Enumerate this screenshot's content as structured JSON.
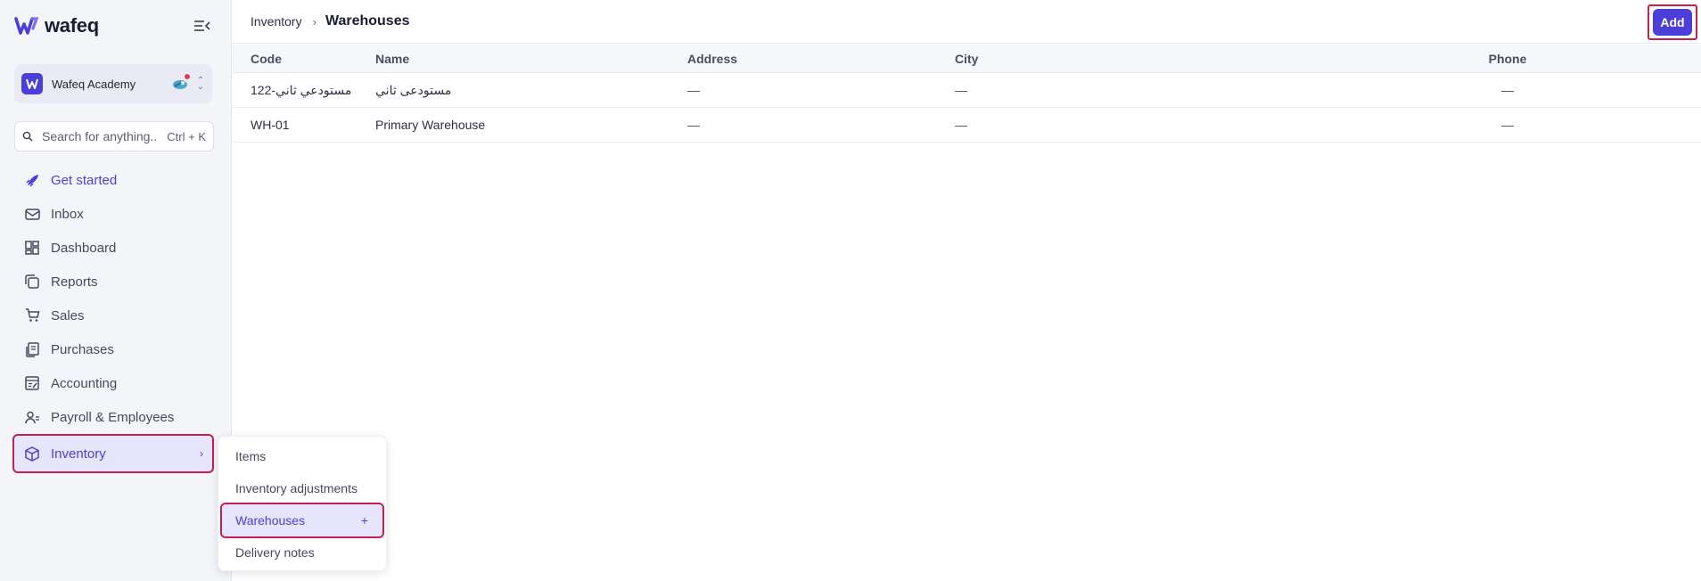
{
  "brand": {
    "name": "wafeq"
  },
  "org": {
    "name": "Wafeq Academy"
  },
  "search": {
    "placeholder": "Search for anything...",
    "shortcut": "Ctrl + K"
  },
  "nav": {
    "items": [
      {
        "label": "Get started",
        "icon": "rocket-icon"
      },
      {
        "label": "Inbox",
        "icon": "inbox-icon"
      },
      {
        "label": "Dashboard",
        "icon": "dashboard-icon"
      },
      {
        "label": "Reports",
        "icon": "reports-icon"
      },
      {
        "label": "Sales",
        "icon": "cart-icon"
      },
      {
        "label": "Purchases",
        "icon": "receipt-icon"
      },
      {
        "label": "Accounting",
        "icon": "ledger-icon"
      },
      {
        "label": "Payroll & Employees",
        "icon": "people-icon"
      },
      {
        "label": "Inventory",
        "icon": "box-icon"
      }
    ]
  },
  "submenu": {
    "items": [
      {
        "label": "Items"
      },
      {
        "label": "Inventory adjustments"
      },
      {
        "label": "Warehouses",
        "action": "+"
      },
      {
        "label": "Delivery notes"
      }
    ]
  },
  "breadcrumb": {
    "parent": "Inventory",
    "separator": "›",
    "current": "Warehouses"
  },
  "toolbar": {
    "add_label": "Add"
  },
  "table": {
    "columns": [
      "Code",
      "Name",
      "Address",
      "City",
      "Phone"
    ],
    "rows": [
      {
        "code": "مستودعي ثاني-122",
        "name": "مستودعى ثاني",
        "address": "—",
        "city": "—",
        "phone": "—"
      },
      {
        "code": "WH-01",
        "name": "Primary Warehouse",
        "address": "—",
        "city": "—",
        "phone": "—"
      }
    ]
  },
  "colors": {
    "accent": "#4c3fd9",
    "highlight": "#c4204f",
    "sidebar_bg": "#f4f5f9",
    "notification": "#e23b4f"
  }
}
